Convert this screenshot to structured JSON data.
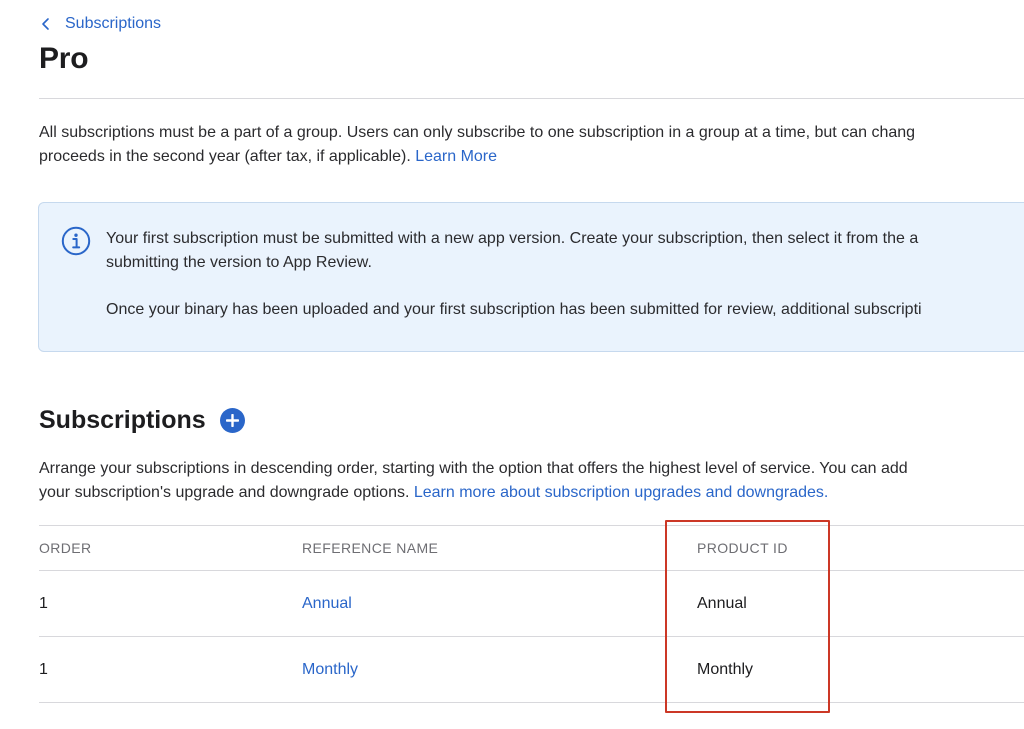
{
  "breadcrumb": {
    "label": "Subscriptions"
  },
  "page": {
    "title": "Pro"
  },
  "intro": {
    "text_line1": "All subscriptions must be a part of a group. Users can only subscribe to one subscription in a group at a time, but can chang",
    "text_line2": "proceeds in the second year (after tax, if applicable). ",
    "learn_more": "Learn More"
  },
  "info_box": {
    "icon": "info-circle-icon",
    "line1": "Your first subscription must be submitted with a new app version. Create your subscription, then select it from the a",
    "line2": "submitting the version to App Review.",
    "line3": "Once your binary has been uploaded and your first subscription has been submitted for review, additional subscripti"
  },
  "subscriptions_section": {
    "title": "Subscriptions",
    "add_icon": "plus-circle-icon",
    "desc_line1": "Arrange your subscriptions in descending order, starting with the option that offers the highest level of service. You can add",
    "desc_line2": "your subscription's upgrade and downgrade options. ",
    "desc_link": "Learn more about subscription upgrades and downgrades."
  },
  "table": {
    "headers": {
      "order": "ORDER",
      "reference_name": "REFERENCE NAME",
      "product_id": "PRODUCT ID"
    },
    "rows": [
      {
        "order": "1",
        "reference_name": "Annual",
        "product_id": "Annual"
      },
      {
        "order": "1",
        "reference_name": "Monthly",
        "product_id": "Monthly"
      }
    ]
  },
  "colors": {
    "link": "#2a66c9",
    "info_bg": "#eaf3fd",
    "highlight": "#cc3826"
  }
}
